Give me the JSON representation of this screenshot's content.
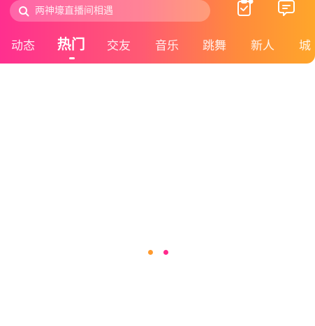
{
  "header": {
    "search": {
      "placeholder": "两神壕直播间相遇",
      "icon": "search-icon"
    },
    "actions": [
      {
        "name": "clipboard-check-icon",
        "badge": true
      },
      {
        "name": "message-square-icon",
        "badge": false
      }
    ],
    "tabs": [
      {
        "label": "动态",
        "active": false
      },
      {
        "label": "热门",
        "active": true
      },
      {
        "label": "交友",
        "active": false
      },
      {
        "label": "音乐",
        "active": false
      },
      {
        "label": "跳舞",
        "active": false
      },
      {
        "label": "新人",
        "active": false
      },
      {
        "label": "城",
        "active": false
      }
    ]
  },
  "loading": {
    "dots": [
      {
        "color": "#ff9a2e"
      },
      {
        "color": "#ff2a8c"
      }
    ]
  },
  "colors": {
    "gradient_start": "#ff2f8f",
    "gradient_end": "#ffa62a"
  }
}
